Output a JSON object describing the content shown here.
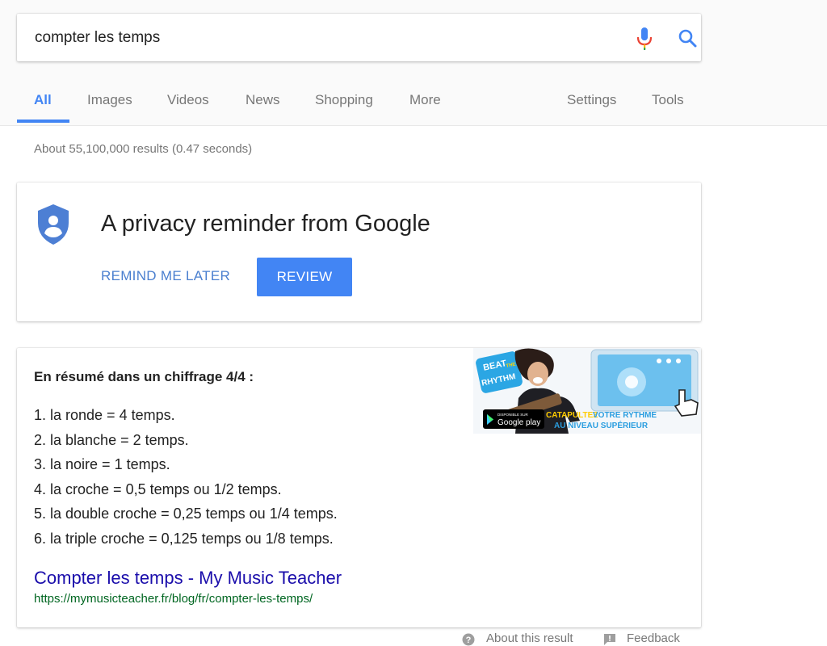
{
  "search": {
    "query": "compter les temps"
  },
  "tabs": [
    {
      "label": "All",
      "active": true
    },
    {
      "label": "Images"
    },
    {
      "label": "Videos"
    },
    {
      "label": "News"
    },
    {
      "label": "Shopping"
    },
    {
      "label": "More"
    },
    {
      "label": "Settings"
    },
    {
      "label": "Tools"
    }
  ],
  "stats": "About 55,100,000 results (0.47 seconds)",
  "privacy": {
    "title": "A privacy reminder from Google",
    "remind_label": "REMIND ME LATER",
    "review_label": "REVIEW"
  },
  "snippet": {
    "heading": "En résumé dans un chiffrage 4/4 :",
    "items": [
      "1. la ronde = 4 temps.",
      "2. la blanche = 2 temps.",
      "3. la noire = 1 temps.",
      "4. la croche = 0,5 temps ou 1/2 temps.",
      "5. la double croche = 0,25 temps ou 1/4 temps.",
      "6. la triple croche = 0,125 temps ou 1/8 temps."
    ],
    "result_title": "Compter les temps - My Music Teacher",
    "result_url": "https://mymusicteacher.fr/blog/fr/compter-les-temps/",
    "image": {
      "badge_line1": "BEAT",
      "badge_line2": "THE",
      "badge_line3": "RHYTHM",
      "store_small": "DISPONIBLE SUR",
      "store_label": "Google play",
      "tagline_line1_a": "CATAPULTEZ",
      "tagline_line1_b": "VOTRE RYTHME",
      "tagline_line2": "AU NIVEAU SUPÉRIEUR"
    }
  },
  "footer": {
    "about_label": "About this result",
    "feedback_label": "Feedback"
  },
  "colors": {
    "accent": "#4285f4",
    "link": "#1a0dab",
    "url": "#006621",
    "muted": "#777777"
  }
}
